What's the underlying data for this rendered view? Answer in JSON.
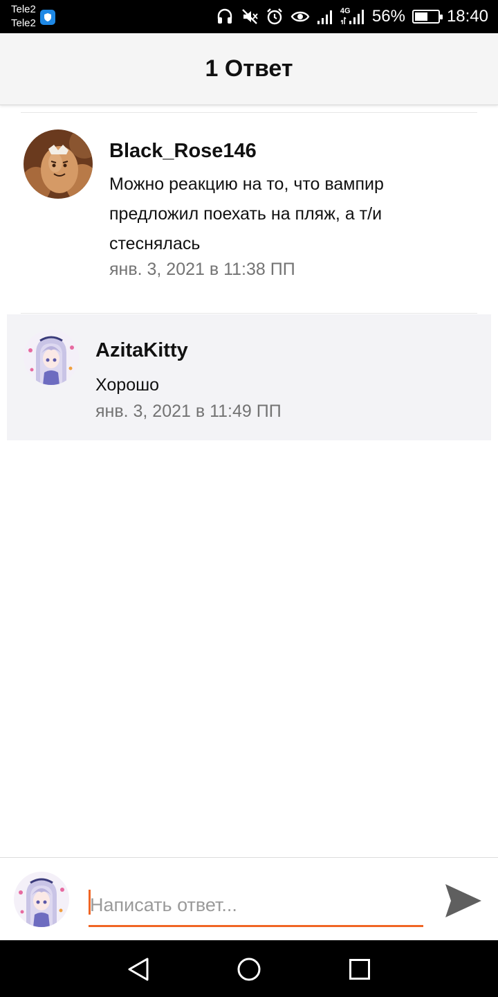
{
  "status_bar": {
    "carrier_1": "Tele2",
    "carrier_2": "Tele2",
    "network_type": "4G",
    "battery_percent": "56%",
    "battery_level": 0.56,
    "time": "18:40",
    "icons": [
      "vpn-shield-icon",
      "headphones-icon",
      "mute-icon",
      "alarm-icon",
      "eye-icon",
      "signal-icon",
      "signal-4g-icon",
      "battery-icon"
    ]
  },
  "header": {
    "title": "1 Ответ"
  },
  "comments": [
    {
      "author": "Black_Rose146",
      "text": "Можно реакцию на то, что вампир предложил поехать на пляж, а т/и стеснялась",
      "time": "янв. 3, 2021 в 11:38 ПП",
      "avatar": "egg-avatar"
    },
    {
      "author": "AzitaKitty",
      "text": "Хорошо",
      "time": "янв. 3, 2021 в 11:49 ПП",
      "avatar": "anime-girl-avatar"
    }
  ],
  "composer": {
    "placeholder": "Написать ответ...",
    "value": "",
    "avatar": "anime-girl-avatar",
    "send_icon": "send-icon",
    "accent_color": "#f06524"
  },
  "nav_bar": {
    "icons": [
      "back-icon",
      "home-icon",
      "recents-icon"
    ]
  }
}
